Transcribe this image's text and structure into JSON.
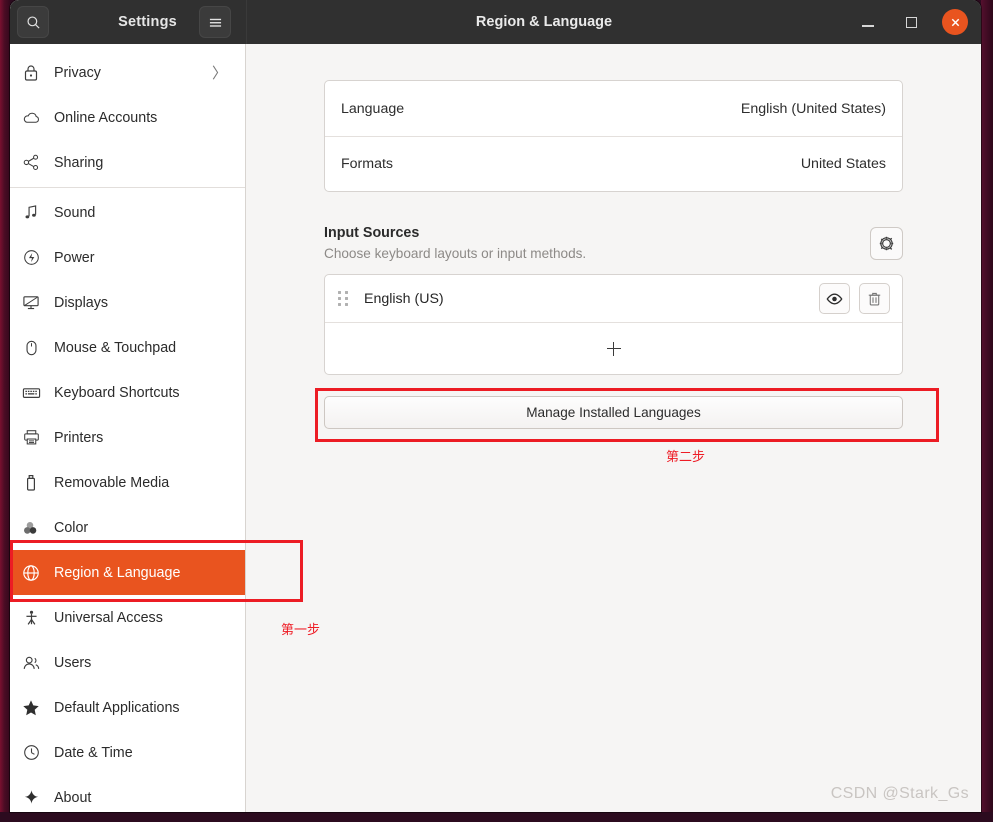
{
  "window": {
    "sidebar_title": "Settings",
    "page_title": "Region & Language",
    "search_icon": "search-icon",
    "menu_icon": "hamburger-menu-icon",
    "minimize_label": "–",
    "maximize_label": "□",
    "close_label": "×",
    "close_color": "#e9541f",
    "titlebar_color": "#303030"
  },
  "sidebar": {
    "accent_color": "#e9541f",
    "items": [
      {
        "label": "Privacy",
        "icon": "lock-icon",
        "chevron": "〉",
        "selected": false
      },
      {
        "label": "Online Accounts",
        "icon": "cloud-icon",
        "selected": false
      },
      {
        "label": "Sharing",
        "icon": "share-nodes-icon",
        "selected": false
      },
      {
        "label": "Sound",
        "icon": "music-note-icon",
        "selected": false
      },
      {
        "label": "Power",
        "icon": "power-icon",
        "selected": false
      },
      {
        "label": "Displays",
        "icon": "monitor-icon",
        "selected": false
      },
      {
        "label": "Mouse & Touchpad",
        "icon": "mouse-icon",
        "selected": false
      },
      {
        "label": "Keyboard Shortcuts",
        "icon": "keyboard-icon",
        "selected": false
      },
      {
        "label": "Printers",
        "icon": "printer-icon",
        "selected": false
      },
      {
        "label": "Removable Media",
        "icon": "usb-drive-icon",
        "selected": false
      },
      {
        "label": "Color",
        "icon": "color-circles-icon",
        "selected": false
      },
      {
        "label": "Region & Language",
        "icon": "globe-icon",
        "selected": true
      },
      {
        "label": "Universal Access",
        "icon": "accessibility-icon",
        "selected": false
      },
      {
        "label": "Users",
        "icon": "users-icon",
        "selected": false
      },
      {
        "label": "Default Applications",
        "icon": "star-icon",
        "selected": false
      },
      {
        "label": "Date & Time",
        "icon": "clock-icon",
        "selected": false
      },
      {
        "label": "About",
        "icon": "sparkle-icon",
        "selected": false
      }
    ]
  },
  "main": {
    "rows": [
      {
        "key": "Language",
        "value": "English (United States)"
      },
      {
        "key": "Formats",
        "value": "United States"
      }
    ],
    "input_sources": {
      "title": "Input Sources",
      "subtitle": "Choose keyboard layouts or input methods.",
      "settings_icon": "gear-icon",
      "entries": [
        {
          "name": "English (US)",
          "grip_icon": "drag-handle-icon",
          "preview_icon": "eye-icon",
          "remove_icon": "trash-icon"
        }
      ],
      "add_icon": "plus-icon"
    },
    "manage_button": "Manage Installed Languages"
  },
  "annotations": {
    "color": "#ec1c24",
    "step_one": "第一步",
    "step_two": "第二步"
  },
  "watermark": "CSDN @Stark_Gs"
}
